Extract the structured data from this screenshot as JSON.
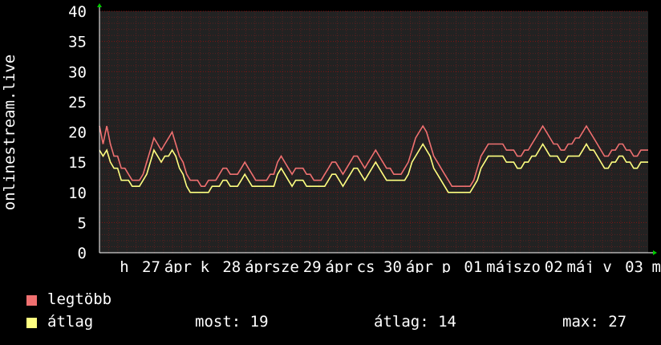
{
  "chart_data": {
    "type": "line",
    "ylabel": "onlinestream.live",
    "ylim": [
      0,
      40
    ],
    "yticks": [
      0,
      5,
      10,
      15,
      20,
      25,
      30,
      35,
      40
    ],
    "xtick_labels": [
      "h",
      "27",
      "ápr",
      "k",
      "28",
      "ápr",
      "sze",
      "29",
      "ápr",
      "cs",
      "30",
      "ápr",
      "p",
      "01",
      "máj",
      "szo",
      "02",
      "máj",
      "v",
      "03",
      "má"
    ],
    "grid": true,
    "background": "#222222",
    "gridColor": "#ff0000",
    "series": [
      {
        "name": "legtöbb",
        "color": "#f07070",
        "values": [
          21,
          18,
          21,
          18,
          16,
          16,
          14,
          14,
          13,
          12,
          12,
          12,
          13,
          15,
          17,
          19,
          18,
          17,
          18,
          19,
          20,
          18,
          16,
          15,
          13,
          12,
          12,
          12,
          11,
          11,
          12,
          12,
          12,
          13,
          14,
          14,
          13,
          13,
          13,
          14,
          15,
          14,
          13,
          12,
          12,
          12,
          12,
          13,
          13,
          15,
          16,
          15,
          14,
          13,
          14,
          14,
          14,
          13,
          13,
          12,
          12,
          12,
          13,
          14,
          15,
          15,
          14,
          13,
          14,
          15,
          16,
          16,
          15,
          14,
          15,
          16,
          17,
          16,
          15,
          14,
          14,
          13,
          13,
          13,
          14,
          15,
          17,
          19,
          20,
          21,
          20,
          18,
          16,
          15,
          14,
          13,
          12,
          11,
          11,
          11,
          11,
          11,
          11,
          12,
          14,
          16,
          17,
          18,
          18,
          18,
          18,
          18,
          17,
          17,
          17,
          16,
          16,
          17,
          17,
          18,
          19,
          20,
          21,
          20,
          19,
          18,
          18,
          17,
          17,
          18,
          18,
          19,
          19,
          20,
          21,
          20,
          19,
          18,
          17,
          16,
          16,
          17,
          17,
          18,
          18,
          17,
          17,
          16,
          16,
          17,
          17,
          17
        ]
      },
      {
        "name": "átlag",
        "color": "#ffff80",
        "values": [
          17,
          16,
          17,
          15,
          14,
          14,
          12,
          12,
          12,
          11,
          11,
          11,
          12,
          13,
          15,
          17,
          16,
          15,
          16,
          16,
          17,
          16,
          14,
          13,
          11,
          10,
          10,
          10,
          10,
          10,
          10,
          11,
          11,
          11,
          12,
          12,
          11,
          11,
          11,
          12,
          13,
          12,
          11,
          11,
          11,
          11,
          11,
          11,
          11,
          13,
          14,
          13,
          12,
          11,
          12,
          12,
          12,
          11,
          11,
          11,
          11,
          11,
          11,
          12,
          13,
          13,
          12,
          11,
          12,
          13,
          14,
          14,
          13,
          12,
          13,
          14,
          15,
          14,
          13,
          12,
          12,
          12,
          12,
          12,
          12,
          13,
          15,
          16,
          17,
          18,
          17,
          16,
          14,
          13,
          12,
          11,
          10,
          10,
          10,
          10,
          10,
          10,
          10,
          11,
          12,
          14,
          15,
          16,
          16,
          16,
          16,
          16,
          15,
          15,
          15,
          14,
          14,
          15,
          15,
          16,
          16,
          17,
          18,
          17,
          16,
          16,
          16,
          15,
          15,
          16,
          16,
          16,
          16,
          17,
          18,
          17,
          17,
          16,
          15,
          14,
          14,
          15,
          15,
          16,
          16,
          15,
          15,
          14,
          14,
          15,
          15,
          15
        ]
      }
    ]
  },
  "legend": [
    {
      "label": "legtöbb",
      "color": "#f07070"
    },
    {
      "label": "átlag",
      "color": "#ffff80"
    }
  ],
  "stats": {
    "now": "most: 19",
    "avg": "átlag: 14",
    "max": "max: 27"
  }
}
